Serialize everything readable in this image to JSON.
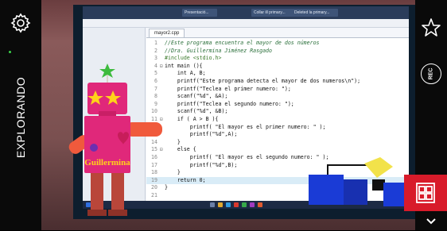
{
  "app": {
    "mode_label": "EXPLORANDO"
  },
  "colors": {
    "robot_body": "#e0287a",
    "robot_arm": "#f05a3c",
    "robot_leg": "#b9463a",
    "robot_eye": "#ffd21a",
    "robot_antenna": "#3dbb3d",
    "block_blue": "#1a3bd6",
    "block_yellow": "#f2e24a",
    "ar_card": "#d81b2a"
  },
  "icons": {
    "settings": "gear-icon",
    "favorite": "star-icon",
    "record": "rec-icon",
    "block_menu": "blocks-icon",
    "collapse": "chevron-down-icon"
  },
  "hud": {
    "record_label": "REC",
    "robot_name": "Guillermina"
  },
  "screen": {
    "window_tabs": [
      "Presentació...",
      "Collar ill primary...",
      "Deleted la primary..."
    ],
    "file_tab": "mayor2.cpp",
    "code_lines": [
      {
        "num": "1",
        "text": "//Este programa encuentra el mayor de dos números",
        "kind": "comment"
      },
      {
        "num": "2",
        "text": "//Dra. Guillermina Jiménez Rasgado",
        "kind": "comment"
      },
      {
        "num": "3",
        "text": "#include <stdio.h>",
        "kind": "pre"
      },
      {
        "num": "4",
        "text": "int main (){",
        "kind": "code",
        "fold": "⊟"
      },
      {
        "num": "5",
        "text": "    int A, B;",
        "kind": "code"
      },
      {
        "num": "6",
        "text": "    printf(\"Este programa detecta el mayor de dos numeros\\n\");",
        "kind": "code"
      },
      {
        "num": "7",
        "text": "    printf(\"Teclea el primer numero: \");",
        "kind": "code"
      },
      {
        "num": "8",
        "text": "    scanf(\"%d\", &A);",
        "kind": "code"
      },
      {
        "num": "9",
        "text": "    printf(\"Teclea el segundo numero: \");",
        "kind": "code"
      },
      {
        "num": "10",
        "text": "    scanf(\"%d\", &B);",
        "kind": "code"
      },
      {
        "num": "11",
        "text": "    if ( A > B ){",
        "kind": "code",
        "fold": "⊟"
      },
      {
        "num": "12",
        "text": "        printf( \"El mayor es el primer numero: \" );",
        "kind": "code"
      },
      {
        "num": "13",
        "text": "        printf(\"%d\",A);",
        "kind": "code"
      },
      {
        "num": "14",
        "text": "    }",
        "kind": "code"
      },
      {
        "num": "15",
        "text": "    else {",
        "kind": "code",
        "fold": "⊟"
      },
      {
        "num": "16",
        "text": "        printf( \"El mayor es el segundo numero: \" );",
        "kind": "code"
      },
      {
        "num": "17",
        "text": "        printf(\"%d\",B);",
        "kind": "code"
      },
      {
        "num": "18",
        "text": "    }",
        "kind": "code"
      },
      {
        "num": "19",
        "text": "    return 0;",
        "kind": "code",
        "highlight": true
      },
      {
        "num": "20",
        "text": "}",
        "kind": "code"
      },
      {
        "num": "21",
        "text": "",
        "kind": "code"
      }
    ]
  }
}
